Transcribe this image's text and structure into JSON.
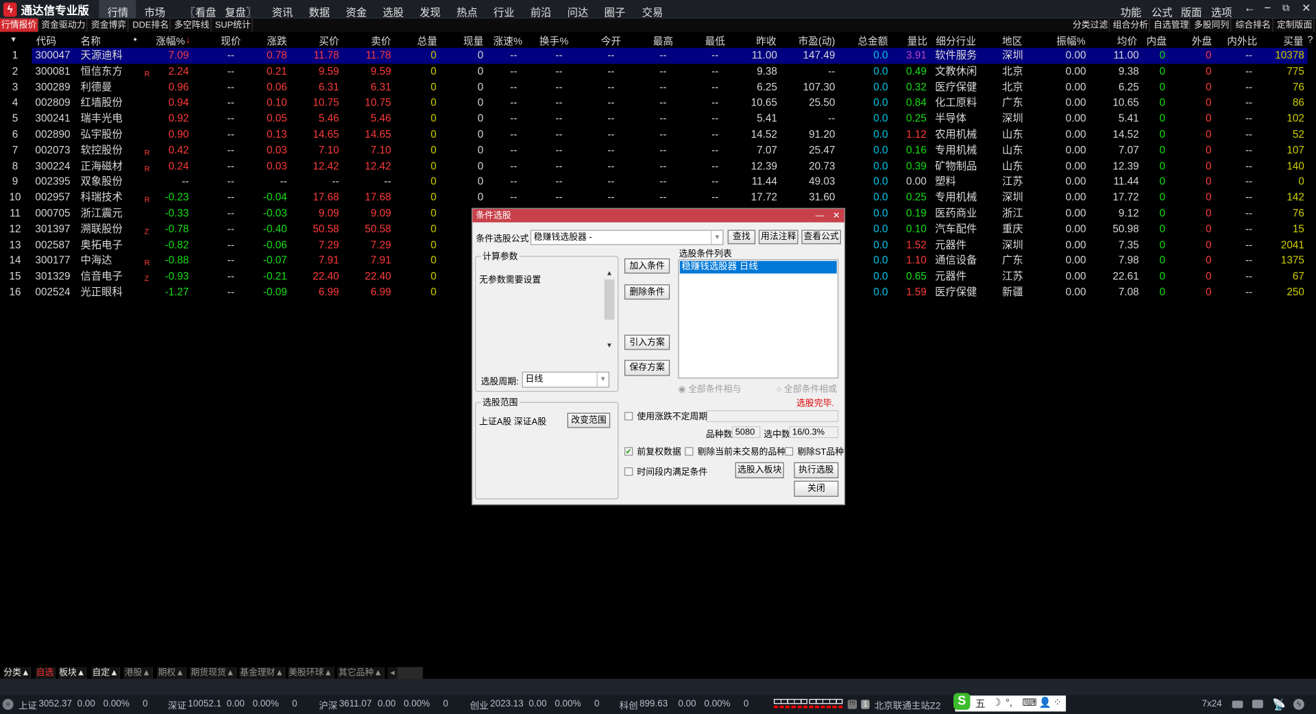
{
  "app": {
    "title": "通达信专业版",
    "logo_icon": "tdx-logo-icon"
  },
  "menu": [
    "行情",
    "市场",
    "〖看盘",
    "复盘〗",
    "资讯",
    "数据",
    "资金",
    "选股",
    "发现",
    "热点",
    "行业",
    "前沿",
    "问达",
    "圈子",
    "交易"
  ],
  "menu_active": "行情",
  "menu_right": [
    "功能",
    "公式",
    "版面",
    "选项"
  ],
  "window_icons": [
    "back-arrow-icon",
    "minimize-icon",
    "restore-icon",
    "close-icon"
  ],
  "subtabs": [
    "行情报价",
    "资金驱动力",
    "资金博弈",
    "DDE排名",
    "多空阵线",
    "SUP统计"
  ],
  "subtabs_right": [
    "分类过滤",
    "组合分析",
    "自选管理",
    "多股同列",
    "综合排名",
    "定制版面"
  ],
  "table": {
    "headers": [
      "代码",
      "名称",
      "•",
      "涨幅%",
      "现价",
      "涨跌",
      "买价",
      "卖价",
      "总量",
      "现量",
      "涨速%",
      "换手%",
      "今开",
      "最高",
      "最低",
      "昨收",
      "市盈(动)",
      "总金额",
      "量比",
      "细分行业",
      "地区",
      "振幅%",
      "均价",
      "内盘",
      "外盘",
      "内外比",
      "买量",
      "?"
    ],
    "sort_column": "涨幅%",
    "sort_direction": "desc",
    "selected_row": 1,
    "rows": [
      [
        "1",
        "300047",
        "天源迪科",
        "",
        "7.09",
        "--",
        "0.78",
        "11.78",
        "11.78",
        "0",
        "0",
        "--",
        "--",
        "--",
        "--",
        "--",
        "11.00",
        "147.49",
        "0.0",
        "3.91",
        "软件服务",
        "深圳",
        "0.00",
        "11.00",
        "0",
        "0",
        "--",
        "10378"
      ],
      [
        "2",
        "300081",
        "恒信东方",
        "R",
        "2.24",
        "--",
        "0.21",
        "9.59",
        "9.59",
        "0",
        "0",
        "--",
        "--",
        "--",
        "--",
        "--",
        "9.38",
        "--",
        "0.0",
        "0.49",
        "文教休闲",
        "北京",
        "0.00",
        "9.38",
        "0",
        "0",
        "--",
        "775"
      ],
      [
        "3",
        "300289",
        "利德曼",
        "",
        "0.96",
        "--",
        "0.06",
        "6.31",
        "6.31",
        "0",
        "0",
        "--",
        "--",
        "--",
        "--",
        "--",
        "6.25",
        "107.30",
        "0.0",
        "0.32",
        "医疗保健",
        "北京",
        "0.00",
        "6.25",
        "0",
        "0",
        "--",
        "76"
      ],
      [
        "4",
        "002809",
        "红墙股份",
        "",
        "0.94",
        "--",
        "0.10",
        "10.75",
        "10.75",
        "0",
        "0",
        "--",
        "--",
        "--",
        "--",
        "--",
        "10.65",
        "25.50",
        "0.0",
        "0.84",
        "化工原料",
        "广东",
        "0.00",
        "10.65",
        "0",
        "0",
        "--",
        "86"
      ],
      [
        "5",
        "300241",
        "瑞丰光电",
        "",
        "0.92",
        "--",
        "0.05",
        "5.46",
        "5.46",
        "0",
        "0",
        "--",
        "--",
        "--",
        "--",
        "--",
        "5.41",
        "--",
        "0.0",
        "0.25",
        "半导体",
        "深圳",
        "0.00",
        "5.41",
        "0",
        "0",
        "--",
        "102"
      ],
      [
        "6",
        "002890",
        "弘宇股份",
        "",
        "0.90",
        "--",
        "0.13",
        "14.65",
        "14.65",
        "0",
        "0",
        "--",
        "--",
        "--",
        "--",
        "--",
        "14.52",
        "91.20",
        "0.0",
        "1.12",
        "农用机械",
        "山东",
        "0.00",
        "14.52",
        "0",
        "0",
        "--",
        "52"
      ],
      [
        "7",
        "002073",
        "软控股份",
        "R",
        "0.42",
        "--",
        "0.03",
        "7.10",
        "7.10",
        "0",
        "0",
        "--",
        "--",
        "--",
        "--",
        "--",
        "7.07",
        "25.47",
        "0.0",
        "0.16",
        "专用机械",
        "山东",
        "0.00",
        "7.07",
        "0",
        "0",
        "--",
        "107"
      ],
      [
        "8",
        "300224",
        "正海磁材",
        "R",
        "0.24",
        "--",
        "0.03",
        "12.42",
        "12.42",
        "0",
        "0",
        "--",
        "--",
        "--",
        "--",
        "--",
        "12.39",
        "20.73",
        "0.0",
        "0.39",
        "矿物制品",
        "山东",
        "0.00",
        "12.39",
        "0",
        "0",
        "--",
        "140"
      ],
      [
        "9",
        "002395",
        "双象股份",
        "",
        "--",
        "--",
        "--",
        "--",
        "--",
        "0",
        "0",
        "--",
        "--",
        "--",
        "--",
        "--",
        "11.44",
        "49.03",
        "0.0",
        "0.00",
        "塑料",
        "江苏",
        "0.00",
        "11.44",
        "0",
        "0",
        "--",
        "0"
      ],
      [
        "10",
        "002957",
        "科瑞技术",
        "R",
        "-0.23",
        "--",
        "-0.04",
        "17.68",
        "17.68",
        "0",
        "0",
        "--",
        "--",
        "--",
        "--",
        "--",
        "17.72",
        "31.60",
        "0.0",
        "0.25",
        "专用机械",
        "深圳",
        "0.00",
        "17.72",
        "0",
        "0",
        "--",
        "142"
      ],
      [
        "11",
        "000705",
        "浙江震元",
        "",
        "-0.33",
        "--",
        "-0.03",
        "9.09",
        "9.09",
        "0",
        null,
        null,
        null,
        null,
        null,
        null,
        null,
        null,
        "0.0",
        "0.19",
        "医药商业",
        "浙江",
        "0.00",
        "9.12",
        "0",
        "0",
        "--",
        "76"
      ],
      [
        "12",
        "301397",
        "溯联股份",
        "Z",
        "-0.78",
        "--",
        "-0.40",
        "50.58",
        "50.58",
        "0",
        null,
        null,
        null,
        null,
        null,
        null,
        null,
        null,
        "0.0",
        "0.10",
        "汽车配件",
        "重庆",
        "0.00",
        "50.98",
        "0",
        "0",
        "--",
        "15"
      ],
      [
        "13",
        "002587",
        "奥拓电子",
        "",
        "-0.82",
        "--",
        "-0.06",
        "7.29",
        "7.29",
        "0",
        null,
        null,
        null,
        null,
        null,
        null,
        null,
        null,
        "0.0",
        "1.52",
        "元器件",
        "深圳",
        "0.00",
        "7.35",
        "0",
        "0",
        "--",
        "2041"
      ],
      [
        "14",
        "300177",
        "中海达",
        "R",
        "-0.88",
        "--",
        "-0.07",
        "7.91",
        "7.91",
        "0",
        null,
        null,
        null,
        null,
        null,
        null,
        null,
        null,
        "0.0",
        "1.10",
        "通信设备",
        "广东",
        "0.00",
        "7.98",
        "0",
        "0",
        "--",
        "1375"
      ],
      [
        "15",
        "301329",
        "信音电子",
        "Z",
        "-0.93",
        "--",
        "-0.21",
        "22.40",
        "22.40",
        "0",
        null,
        null,
        null,
        null,
        null,
        null,
        null,
        null,
        "0.0",
        "0.65",
        "元器件",
        "江苏",
        "0.00",
        "22.61",
        "0",
        "0",
        "--",
        "67"
      ],
      [
        "16",
        "002524",
        "光正眼科",
        "",
        "-1.27",
        "--",
        "-0.09",
        "6.99",
        "6.99",
        "0",
        null,
        null,
        null,
        null,
        null,
        null,
        null,
        null,
        "0.0",
        "1.59",
        "医疗保健",
        "新疆",
        "0.00",
        "7.08",
        "0",
        "0",
        "--",
        "250"
      ]
    ]
  },
  "dialog": {
    "title": "条件选股",
    "formula_label": "条件选股公式",
    "formula_value": "稳赚钱选股器 -",
    "find": "查找",
    "usage": "用法注释",
    "view_formula": "查看公式",
    "params_group": "计算参数",
    "params_text": "无参数需要设置",
    "period_label": "选股周期:",
    "period_value": "日线",
    "add": "加入条件",
    "delete": "删除条件",
    "import": "引入方案",
    "save": "保存方案",
    "list_label": "选股条件列表",
    "list_items": [
      "稳赚钱选股器  日线"
    ],
    "radio_and": "全部条件相与",
    "radio_or": "全部条件相或",
    "radio_selected": "全部条件相与",
    "status": "选股完毕.",
    "range_group": "选股范围",
    "range_text": "上证A股 深证A股",
    "change_range": "改变范围",
    "use_period": "使用涨跌不定周期",
    "use_period_checked": false,
    "count_label": "品种数",
    "count_value": "5080",
    "selected_label": "选中数",
    "selected_value": "16/0.3%",
    "fq": "前复权数据",
    "fq_checked": true,
    "exclude_untraded": "剔除当前未交易的品种",
    "exclude_untraded_checked": false,
    "exclude_st": "剔除ST品种",
    "exclude_st_checked": false,
    "time_range": "时间段内满足条件",
    "time_range_checked": false,
    "to_block": "选股入板块",
    "execute": "执行选股",
    "close": "关闭"
  },
  "bottom_tabs": [
    "分类▲",
    "自选",
    "板块▲",
    "自定▲",
    "港股▲",
    "期权▲",
    "期货现货▲",
    "基金理财▲",
    "美股环球▲",
    "其它品种▲"
  ],
  "bottom_active": "自选",
  "status": {
    "indices": [
      {
        "name": "上证",
        "value": "3052.37",
        "chg": "0.00",
        "pct": "0.00%",
        "vol": "0"
      },
      {
        "name": "深证",
        "value": "10052.1",
        "chg": "0.00",
        "pct": "0.00%",
        "vol": "0"
      },
      {
        "name": "沪深",
        "value": "3611.07",
        "chg": "0.00",
        "pct": "0.00%",
        "vol": "0"
      },
      {
        "name": "创业",
        "value": "2023.13",
        "chg": "0.00",
        "pct": "0.00%",
        "vol": "0"
      },
      {
        "name": "科创",
        "value": "899.63",
        "chg": "0.00",
        "pct": "0.00%",
        "vol": "0"
      }
    ],
    "server": "北京联通主站Z2",
    "ime": [
      "五",
      "☽",
      "°,",
      "⌨",
      "👤",
      "⁘"
    ],
    "news": "7x24"
  },
  "colors": {
    "up": "#ff3b3b",
    "down": "#18e018",
    "selected_row": "#000080",
    "dialog_title": "#c8414a",
    "active_tab": "#d0282e"
  }
}
